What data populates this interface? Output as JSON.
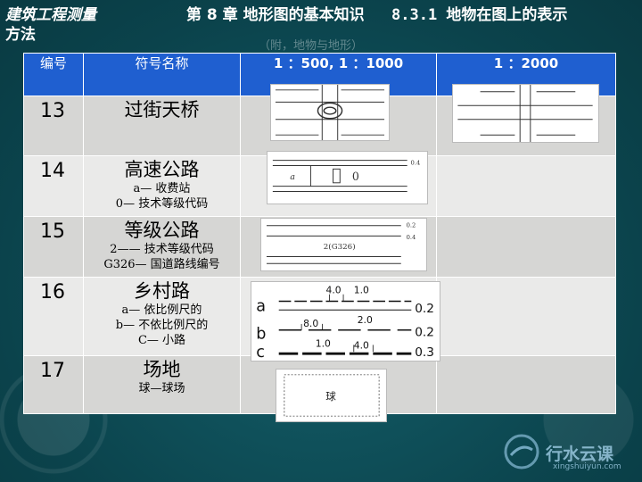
{
  "header": {
    "course": "建筑工程测量",
    "chapter": "第 8 章  地形图的基本知识",
    "section": "8.3.1  地物在图上的表示",
    "section_cont": "方法",
    "ghost_text": "（附，地物与地形）"
  },
  "table": {
    "columns": [
      "编号",
      "符号名称",
      "1 ：500,    1 ：1000",
      "1 ：2000"
    ],
    "rows": [
      {
        "num": "13",
        "name": "过街天桥",
        "subs": []
      },
      {
        "num": "14",
        "name": "高速公路",
        "subs": [
          "a— 收费站",
          "0— 技术等级代码"
        ]
      },
      {
        "num": "15",
        "name": "等级公路",
        "subs": [
          "2—— 技术等级代码",
          "G326— 国道路线编号"
        ]
      },
      {
        "num": "16",
        "name": "乡村路",
        "subs": [
          "a— 依比例尺的",
          "b— 不依比例尺的",
          "C— 小路"
        ]
      },
      {
        "num": "17",
        "name": "场地",
        "subs": [
          "球—球场"
        ]
      }
    ]
  },
  "symbols": {
    "expressway_a": "a",
    "expressway_0": "0",
    "expressway_w": "0.4",
    "grade_w1": "0.2",
    "grade_w2": "0.4",
    "grade_code": "2(G326)",
    "village": {
      "a": "a",
      "b": "b",
      "c": "c",
      "top1": "4.0",
      "top2": "1.0",
      "mid1": "8.0",
      "mid2": "2.0",
      "bot1": "1.0",
      "bot2": "4.0",
      "wa": "0.2",
      "wb": "0.2",
      "wc": "0.3"
    },
    "field_label": "球"
  },
  "watermark": {
    "brand": "行水云课",
    "url": "xingshuiyun.com"
  }
}
